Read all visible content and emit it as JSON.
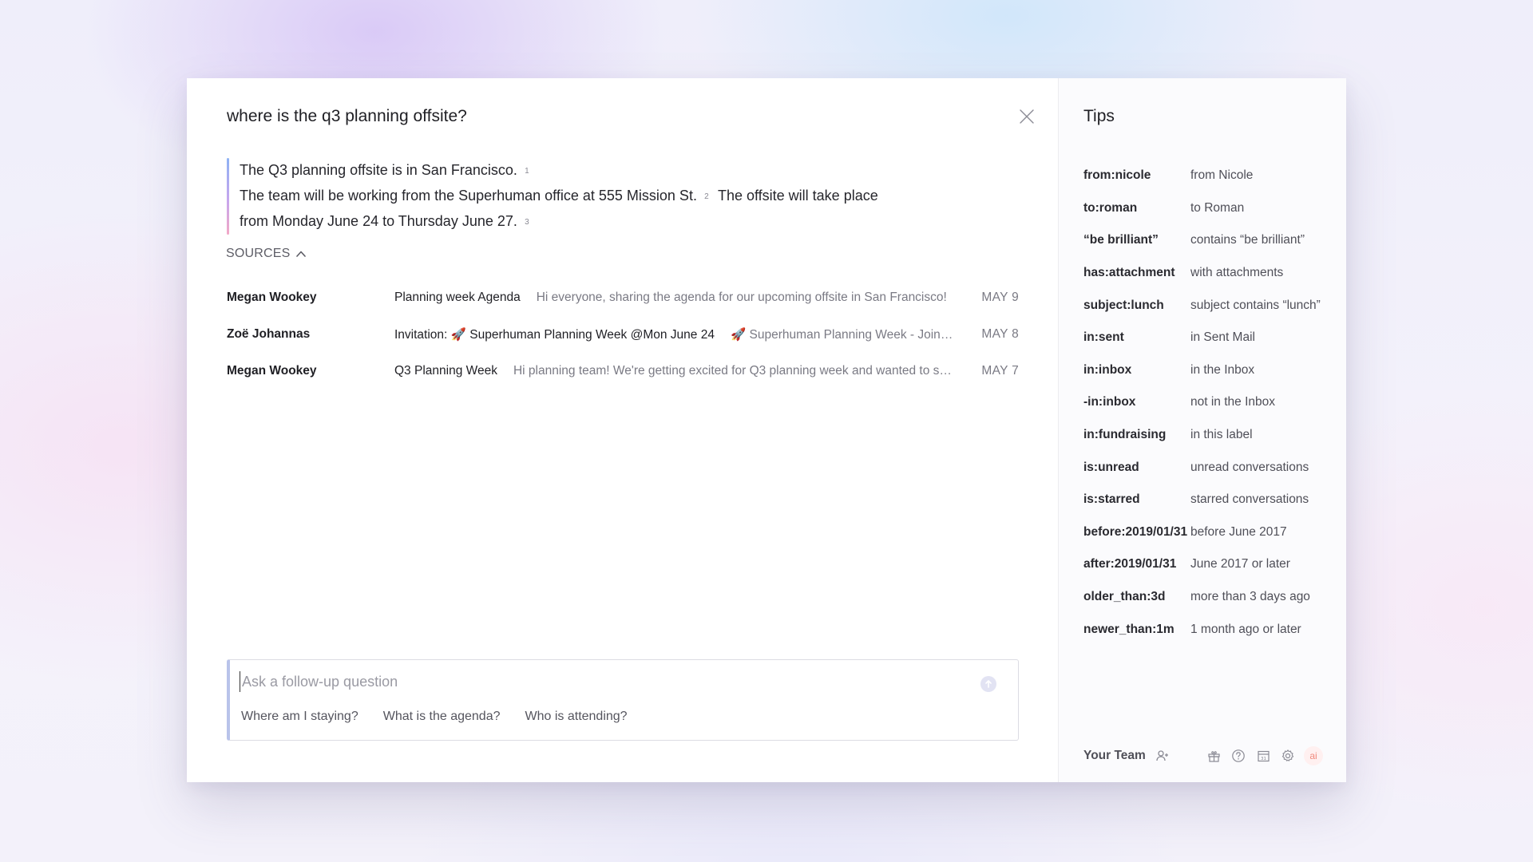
{
  "search": {
    "query": "where is the q3 planning offsite?"
  },
  "answer": {
    "lines": [
      {
        "text": "The Q3 planning offsite is in San Francisco.",
        "cite": "1",
        "text_after": ""
      },
      {
        "text": "The team will be working from the Superhuman office at 555 Mission St.",
        "cite": "2",
        "text_after": "The offsite will take place"
      },
      {
        "text": "from Monday June 24 to Thursday June 27.",
        "cite": "3",
        "text_after": ""
      }
    ]
  },
  "sources": {
    "label": "SOURCES",
    "items": [
      {
        "sender": "Megan Wookey",
        "subject": "Planning week Agenda",
        "snippet": "Hi everyone, sharing the agenda for our upcoming offsite in San Francisco!",
        "date": "MAY 9"
      },
      {
        "sender": "Zoë Johannas",
        "subject": "Invitation: 🚀 Superhuman Planning Week @Mon June 24",
        "snippet": "🚀 Superhuman Planning Week - Join using",
        "date": "MAY 8"
      },
      {
        "sender": "Megan Wookey",
        "subject": "Q3 Planning Week",
        "snippet": "Hi planning team! We're getting excited for Q3 planning week and wanted to sha...",
        "date": "MAY 7"
      }
    ]
  },
  "followup": {
    "placeholder": "Ask a follow-up question",
    "value": "",
    "suggestions": [
      "Where am I staying?",
      "What is the agenda?",
      "Who is attending?"
    ]
  },
  "tips": {
    "title": "Tips",
    "items": [
      {
        "key": "from:nicole",
        "desc": "from Nicole"
      },
      {
        "key": "to:roman",
        "desc": "to Roman"
      },
      {
        "key": "“be brilliant”",
        "desc": "contains “be brilliant”"
      },
      {
        "key": "has:attachment",
        "desc": "with attachments"
      },
      {
        "key": "subject:lunch",
        "desc": "subject contains “lunch”"
      },
      {
        "key": "in:sent",
        "desc": "in Sent Mail"
      },
      {
        "key": "in:inbox",
        "desc": "in the Inbox"
      },
      {
        "key": "-in:inbox",
        "desc": "not in the Inbox"
      },
      {
        "key": "in:fundraising",
        "desc": "in this label"
      },
      {
        "key": "is:unread",
        "desc": "unread conversations"
      },
      {
        "key": "is:starred",
        "desc": "starred conversations"
      },
      {
        "key": "before:2019/01/31",
        "desc": "before June 2017"
      },
      {
        "key": "after:2019/01/31",
        "desc": "June 2017 or later"
      },
      {
        "key": "older_than:3d",
        "desc": "more than 3 days ago"
      },
      {
        "key": "newer_than:1m",
        "desc": "1 month ago or later"
      }
    ]
  },
  "footer": {
    "team_label": "Your Team",
    "ai_label": "ai",
    "icons": [
      "add-user-icon",
      "gift-icon",
      "help-icon",
      "calendar-icon",
      "settings-icon"
    ]
  },
  "colors": {
    "accent_gradient_top": "#8eb2f4",
    "accent_gradient_mid": "#c6a6ee",
    "accent_gradient_bottom": "#f2a8c6",
    "ai_badge": "#f08a7e"
  }
}
